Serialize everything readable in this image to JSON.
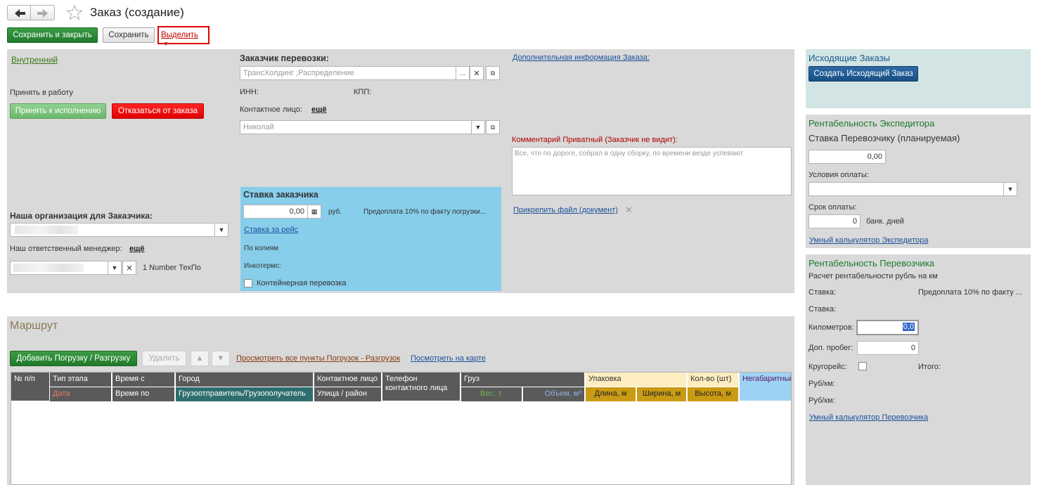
{
  "header": {
    "title": "Заказ (создание)",
    "save_close": "Сохранить и закрыть",
    "save": "Сохранить",
    "select": "Выделить"
  },
  "left": {
    "internal": "Внутренний",
    "accept_title": "Принять в работу",
    "accept_btn": "Принять к исполнению",
    "reject_btn": "Отказаться от заказа",
    "our_org_label": "Наша организация для Заказчика:",
    "manager_label": "Наш ответственный менеджер:",
    "more": "ещё",
    "manager_extra": "1 Number ТехПо"
  },
  "customer": {
    "label": "Заказчик перевозки:",
    "value": "ТрансХолдинг ,Распределение",
    "inn": "ИНН:",
    "kpp": "КПП:",
    "contact_label": "Контактное лицо:",
    "more": "ещё",
    "contact_value": "Николай"
  },
  "rate": {
    "title": "Ставка заказчика",
    "amount": "0,00",
    "currency": "руб.",
    "prepay": "Предоплата 10% по факту погрузки...",
    "per_trip": "Ставка за рейс",
    "copies": "По копиям",
    "incoterms": "Инкотермс:",
    "container": "Контейнерная перевозка"
  },
  "extra": {
    "info_link": "Дополнительная информация Заказа:",
    "comment_label": "Комментарий Приватный (Заказчик не видит):",
    "comment_placeholder": "Все, что по дороге, собрал в одну сборку, по времени везде успевают",
    "attach": "Прикрепить файл (документ)"
  },
  "route": {
    "title": "Маршрут",
    "add_btn": "Добавить Погрузку / Разгрузку",
    "delete_btn": "Удалить",
    "view_all": "Просмотреть все пункты Погрузок - Разгрузок",
    "view_map": "Посмотреть на карте",
    "cols": {
      "num": "№ п/п",
      "stage": "Тип этапа",
      "date": "Дата",
      "time_from": "Время с",
      "time_to": "Время по",
      "city": "Город",
      "shipper": "Грузоотправитель/Грузополучатель",
      "contact": "Контактное лицо",
      "street": "Улица / район",
      "phone": "Телефон контактного лица",
      "cargo": "Груз",
      "weight": "Вес, т.",
      "volume": "Объем, м³",
      "packing": "Упаковка",
      "length": "Длина, м",
      "width": "Ширина, м",
      "qty": "Кол-во (шт)",
      "height": "Высота, м",
      "oversize": "Негабаритный"
    }
  },
  "right": {
    "outgoing_title": "Исходящие Заказы",
    "outgoing_btn": "Создать Исходящий Заказ",
    "exp_title": "Рентабельность Экспедитора",
    "carrier_rate_label": "Ставка Перевозчику (планируемая)",
    "carrier_rate": "0,00",
    "pay_terms_label": "Условия оплаты:",
    "pay_due_label": "Срок оплаты:",
    "pay_due": "0",
    "bank_days": "банк. дней",
    "exp_calc": "Умный калькулятор Экспедитора",
    "carrier_title": "Рентабельность Перевозчика",
    "calc_desc": "Расчет рентабельности рубль на км",
    "rate1_label": "Ставка:",
    "rate1_value": "Предоплата 10% по факту ...",
    "rate2_label": "Ставка:",
    "km_label": "Километров:",
    "km_value": "0,0",
    "extra_run_label": "Доп. пробег:",
    "extra_run_value": "0",
    "round_label": "Кругорейс:",
    "total_label": "Итого:",
    "rub_km1": "Руб/км:",
    "rub_km2": "Руб/км:",
    "carrier_calc": "Умный калькулятор Перевозчика"
  }
}
